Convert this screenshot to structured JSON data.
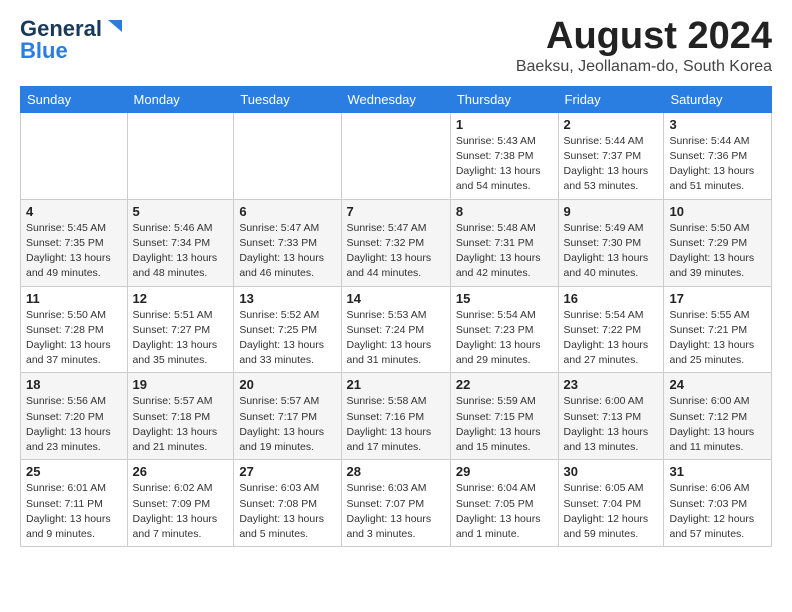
{
  "logo": {
    "text1": "General",
    "text2": "Blue"
  },
  "header": {
    "month_year": "August 2024",
    "location": "Baeksu, Jeollanam-do, South Korea"
  },
  "days_of_week": [
    "Sunday",
    "Monday",
    "Tuesday",
    "Wednesday",
    "Thursday",
    "Friday",
    "Saturday"
  ],
  "weeks": [
    [
      {
        "day": "",
        "info": ""
      },
      {
        "day": "",
        "info": ""
      },
      {
        "day": "",
        "info": ""
      },
      {
        "day": "",
        "info": ""
      },
      {
        "day": "1",
        "info": "Sunrise: 5:43 AM\nSunset: 7:38 PM\nDaylight: 13 hours\nand 54 minutes."
      },
      {
        "day": "2",
        "info": "Sunrise: 5:44 AM\nSunset: 7:37 PM\nDaylight: 13 hours\nand 53 minutes."
      },
      {
        "day": "3",
        "info": "Sunrise: 5:44 AM\nSunset: 7:36 PM\nDaylight: 13 hours\nand 51 minutes."
      }
    ],
    [
      {
        "day": "4",
        "info": "Sunrise: 5:45 AM\nSunset: 7:35 PM\nDaylight: 13 hours\nand 49 minutes."
      },
      {
        "day": "5",
        "info": "Sunrise: 5:46 AM\nSunset: 7:34 PM\nDaylight: 13 hours\nand 48 minutes."
      },
      {
        "day": "6",
        "info": "Sunrise: 5:47 AM\nSunset: 7:33 PM\nDaylight: 13 hours\nand 46 minutes."
      },
      {
        "day": "7",
        "info": "Sunrise: 5:47 AM\nSunset: 7:32 PM\nDaylight: 13 hours\nand 44 minutes."
      },
      {
        "day": "8",
        "info": "Sunrise: 5:48 AM\nSunset: 7:31 PM\nDaylight: 13 hours\nand 42 minutes."
      },
      {
        "day": "9",
        "info": "Sunrise: 5:49 AM\nSunset: 7:30 PM\nDaylight: 13 hours\nand 40 minutes."
      },
      {
        "day": "10",
        "info": "Sunrise: 5:50 AM\nSunset: 7:29 PM\nDaylight: 13 hours\nand 39 minutes."
      }
    ],
    [
      {
        "day": "11",
        "info": "Sunrise: 5:50 AM\nSunset: 7:28 PM\nDaylight: 13 hours\nand 37 minutes."
      },
      {
        "day": "12",
        "info": "Sunrise: 5:51 AM\nSunset: 7:27 PM\nDaylight: 13 hours\nand 35 minutes."
      },
      {
        "day": "13",
        "info": "Sunrise: 5:52 AM\nSunset: 7:25 PM\nDaylight: 13 hours\nand 33 minutes."
      },
      {
        "day": "14",
        "info": "Sunrise: 5:53 AM\nSunset: 7:24 PM\nDaylight: 13 hours\nand 31 minutes."
      },
      {
        "day": "15",
        "info": "Sunrise: 5:54 AM\nSunset: 7:23 PM\nDaylight: 13 hours\nand 29 minutes."
      },
      {
        "day": "16",
        "info": "Sunrise: 5:54 AM\nSunset: 7:22 PM\nDaylight: 13 hours\nand 27 minutes."
      },
      {
        "day": "17",
        "info": "Sunrise: 5:55 AM\nSunset: 7:21 PM\nDaylight: 13 hours\nand 25 minutes."
      }
    ],
    [
      {
        "day": "18",
        "info": "Sunrise: 5:56 AM\nSunset: 7:20 PM\nDaylight: 13 hours\nand 23 minutes."
      },
      {
        "day": "19",
        "info": "Sunrise: 5:57 AM\nSunset: 7:18 PM\nDaylight: 13 hours\nand 21 minutes."
      },
      {
        "day": "20",
        "info": "Sunrise: 5:57 AM\nSunset: 7:17 PM\nDaylight: 13 hours\nand 19 minutes."
      },
      {
        "day": "21",
        "info": "Sunrise: 5:58 AM\nSunset: 7:16 PM\nDaylight: 13 hours\nand 17 minutes."
      },
      {
        "day": "22",
        "info": "Sunrise: 5:59 AM\nSunset: 7:15 PM\nDaylight: 13 hours\nand 15 minutes."
      },
      {
        "day": "23",
        "info": "Sunrise: 6:00 AM\nSunset: 7:13 PM\nDaylight: 13 hours\nand 13 minutes."
      },
      {
        "day": "24",
        "info": "Sunrise: 6:00 AM\nSunset: 7:12 PM\nDaylight: 13 hours\nand 11 minutes."
      }
    ],
    [
      {
        "day": "25",
        "info": "Sunrise: 6:01 AM\nSunset: 7:11 PM\nDaylight: 13 hours\nand 9 minutes."
      },
      {
        "day": "26",
        "info": "Sunrise: 6:02 AM\nSunset: 7:09 PM\nDaylight: 13 hours\nand 7 minutes."
      },
      {
        "day": "27",
        "info": "Sunrise: 6:03 AM\nSunset: 7:08 PM\nDaylight: 13 hours\nand 5 minutes."
      },
      {
        "day": "28",
        "info": "Sunrise: 6:03 AM\nSunset: 7:07 PM\nDaylight: 13 hours\nand 3 minutes."
      },
      {
        "day": "29",
        "info": "Sunrise: 6:04 AM\nSunset: 7:05 PM\nDaylight: 13 hours\nand 1 minute."
      },
      {
        "day": "30",
        "info": "Sunrise: 6:05 AM\nSunset: 7:04 PM\nDaylight: 12 hours\nand 59 minutes."
      },
      {
        "day": "31",
        "info": "Sunrise: 6:06 AM\nSunset: 7:03 PM\nDaylight: 12 hours\nand 57 minutes."
      }
    ]
  ]
}
